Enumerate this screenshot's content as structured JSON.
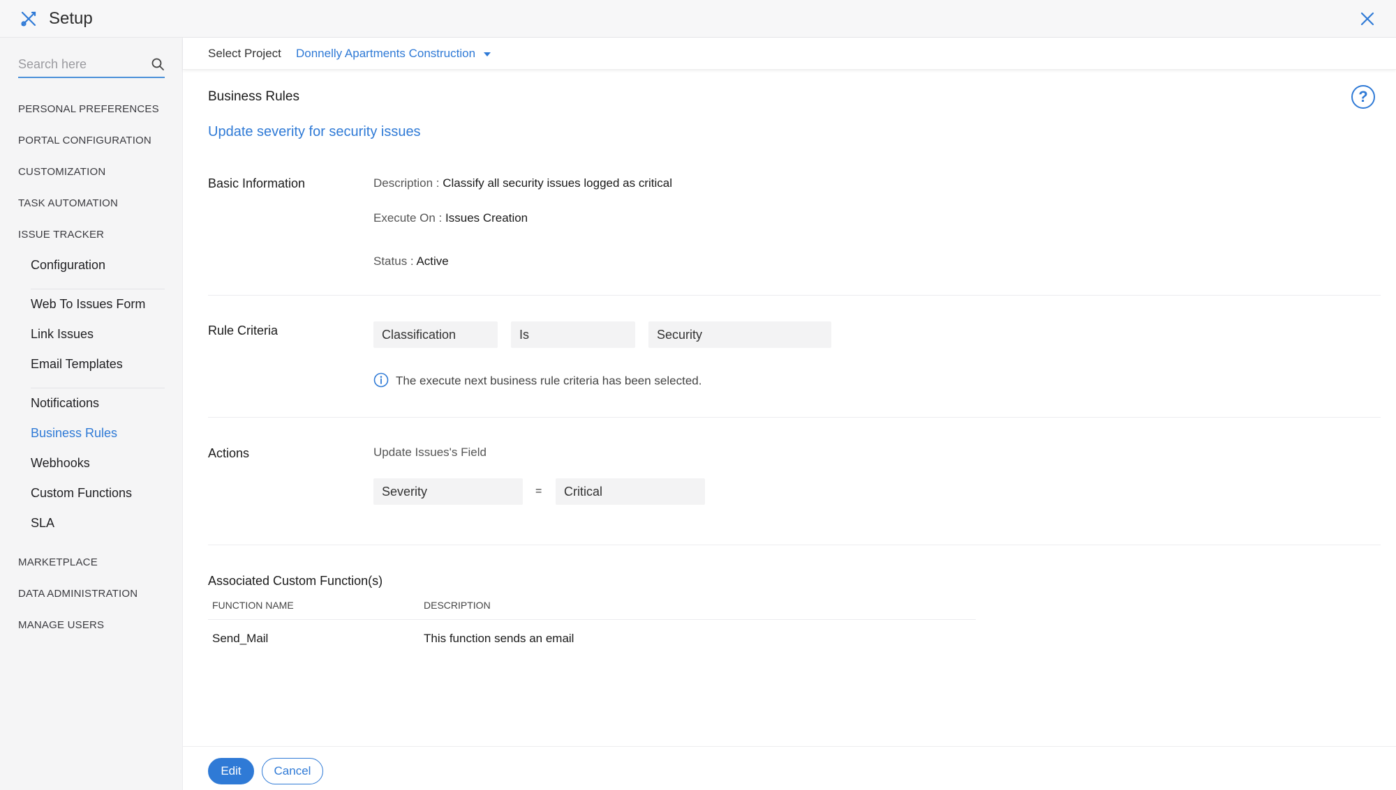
{
  "header": {
    "title": "Setup",
    "app_icon": "tools-icon",
    "close_icon": "close-icon"
  },
  "sidebar": {
    "search_placeholder": "Search here",
    "sections": [
      "PERSONAL PREFERENCES",
      "PORTAL CONFIGURATION",
      "CUSTOMIZATION",
      "TASK AUTOMATION",
      "ISSUE TRACKER",
      "MARKETPLACE",
      "DATA ADMINISTRATION",
      "MANAGE USERS"
    ],
    "issue_tracker_items": [
      "Configuration",
      "Web To Issues Form",
      "Link Issues",
      "Email Templates",
      "Notifications",
      "Business Rules",
      "Webhooks",
      "Custom Functions",
      "SLA"
    ],
    "active_item": "Business Rules"
  },
  "project_bar": {
    "label": "Select Project",
    "selected_project": "Donnelly Apartments Construction"
  },
  "main": {
    "title": "Business Rules",
    "help_label": "?",
    "rule_name": "Update severity for security issues",
    "basic_info": {
      "label": "Basic Information",
      "description_key": "Description :",
      "description_value": "Classify all security issues logged as critical",
      "execute_key": "Execute On :",
      "execute_value": "Issues Creation",
      "status_key": "Status :",
      "status_value": "Active"
    },
    "rule_criteria": {
      "label": "Rule Criteria",
      "field": "Classification",
      "operator": "Is",
      "value": "Security",
      "info_text": "The execute next business rule criteria has been selected."
    },
    "actions": {
      "label": "Actions",
      "subtitle": "Update Issues's Field",
      "field": "Severity",
      "operator": "=",
      "value": "Critical"
    },
    "custom_functions": {
      "title": "Associated Custom Function(s)",
      "columns": [
        "FUNCTION NAME",
        "DESCRIPTION"
      ],
      "rows": [
        [
          "Send_Mail",
          "This function sends an email"
        ]
      ]
    }
  },
  "footer": {
    "edit_label": "Edit",
    "cancel_label": "Cancel"
  },
  "colors": {
    "accent": "#2f7ad6",
    "sidebar_bg": "#f5f5f6",
    "field_bg": "#f3f3f4"
  }
}
